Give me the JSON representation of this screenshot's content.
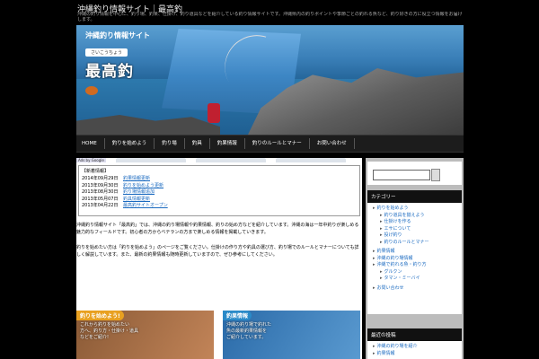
{
  "site": {
    "title": "沖縄釣り情報サイト｜最高釣",
    "description": "沖縄の釣り情報を中心に、釣り場、釣果、仕掛け、釣り道具などを紹介している釣り情報サイトです。沖縄県内の釣りポイントや季節ごとの釣れる魚など、釣り好きの方に役立つ情報をお届けします。"
  },
  "header": {
    "badge_main": "沖縄釣り情報サイト",
    "badge_sub": "さいこうちょう",
    "badge_big": "最高釣"
  },
  "nav": {
    "items": [
      "HOME",
      "釣りを始めよう",
      "釣り場",
      "釣具",
      "釣果情報",
      "釣りのルールとマナー",
      "お問い合わせ"
    ]
  },
  "ads": {
    "label": "Ads by Google"
  },
  "latest": {
    "title": "【新着情報】",
    "rows": [
      {
        "date": "2014年09月29日",
        "text": "釣果情報更新"
      },
      {
        "date": "2013年09月30日",
        "text": "釣りを始めよう更新"
      },
      {
        "date": "2013年08月30日",
        "text": "釣り場情報追加"
      },
      {
        "date": "2013年05月07日",
        "text": "釣具情報更新"
      },
      {
        "date": "2013年04月22日",
        "text": "最高釣サイトオープン"
      }
    ]
  },
  "content": {
    "para1": "沖縄釣り情報サイト「最高釣」では、沖縄の釣り場情報や釣果情報、釣りの始め方などを紹介しています。沖縄の海は一年中釣りが楽しめる魅力的なフィールドです。初心者の方からベテランの方まで楽しめる情報を掲載していきます。",
    "para2": "釣りを始めたい方は「釣りを始めよう」のページをご覧ください。仕掛けの作り方や釣具の選び方、釣り場でのルールとマナーについても詳しく解説しています。また、最新の釣果情報も随時更新していますので、ぜひ参考にしてください。"
  },
  "banners": {
    "left": {
      "head": "釣りを始めよう!",
      "lines": [
        "これから釣りを始めたい",
        "方へ、釣り方・仕掛け・道具",
        "などをご紹介!"
      ]
    },
    "right": {
      "head": "釣果情報",
      "lines": [
        "沖縄の釣り場で釣れた",
        "魚の最新釣果情報を",
        "ご紹介しています。"
      ]
    }
  },
  "sidebar": {
    "search": {
      "value": "",
      "placeholder": ""
    },
    "categories_title": "カテゴリー",
    "categories": [
      {
        "label": "釣りを始めよう",
        "level": 0
      },
      {
        "label": "釣り道具を揃えよう",
        "level": 1
      },
      {
        "label": "仕掛けを作る",
        "level": 1
      },
      {
        "label": "エサについて",
        "level": 1
      },
      {
        "label": "投げ釣り",
        "level": 1
      },
      {
        "label": "釣りのルールとマナー",
        "level": 1
      },
      {
        "label": "釣果情報",
        "level": 0
      },
      {
        "label": "沖縄の釣り場情報",
        "level": 0
      },
      {
        "label": "沖縄で釣れる魚・釣り方",
        "level": 0
      },
      {
        "label": "グルクン",
        "level": 1
      },
      {
        "label": "タマン・ミーバイ",
        "level": 1
      },
      {
        "label": "お問い合わせ",
        "level": 0
      }
    ],
    "recent_title": "最近の投稿",
    "recent": [
      "沖縄の釣り場を紹介",
      "釣果情報"
    ]
  },
  "colors": {
    "accent": "#1a6ac0",
    "nav_bg": "#1c1c1c",
    "sidebar_bg": "#bcbcbc"
  }
}
